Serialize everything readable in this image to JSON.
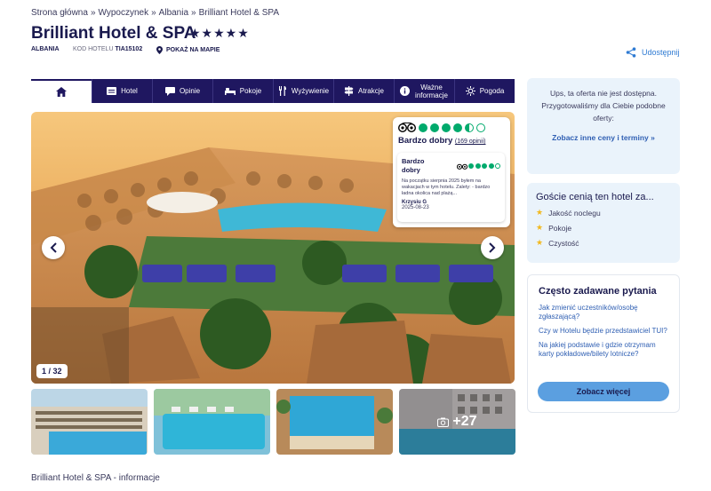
{
  "breadcrumb": [
    "Strona główna",
    "Wypoczynek",
    "Albania",
    "Brilliant Hotel & SPA"
  ],
  "hotel": {
    "name": "Brilliant Hotel & SPA",
    "stars": "★★★★★",
    "country": "ALBANIA",
    "code_label": "KOD HOTELU",
    "code": "TIA15102",
    "map_label": "POKAŻ NA MAPIE",
    "share_label": "Udostępnij"
  },
  "nav": {
    "items": [
      {
        "label": "Hotel",
        "icon": "bed-card-icon"
      },
      {
        "label": "Opinie",
        "icon": "speech-bubble-icon"
      },
      {
        "label": "Pokoje",
        "icon": "bed-icon"
      },
      {
        "label": "Wyżywienie",
        "icon": "cutlery-icon"
      },
      {
        "label": "Atrakcje",
        "icon": "signpost-icon"
      },
      {
        "label": "Ważne informacje",
        "icon": "info-icon"
      },
      {
        "label": "Pogoda",
        "icon": "sun-icon"
      }
    ]
  },
  "gallery": {
    "counter": "1 / 32",
    "more_label": "+27"
  },
  "review": {
    "rating_label": "Bardzo dobry",
    "count_label": "(169 opinii)",
    "rating": 4.5,
    "inner": {
      "label": "Bardzo dobry",
      "rating": 4,
      "text": "Na początku sierpnia 2025 byłem na wakacjach w tym hotelu. Zalety: - bardzo ładna okolica nad plażą...",
      "author": "Krzysiu G",
      "date": "2025-08-23"
    }
  },
  "unavailable": {
    "message": "Ups, ta oferta nie jest dostępna. Przygotowaliśmy dla Ciebie podobne oferty:",
    "link": "Zobacz inne ceny i terminy »"
  },
  "guests": {
    "title": "Goście cenią ten hotel za...",
    "items": [
      "Jakość noclegu",
      "Pokoje",
      "Czystość"
    ]
  },
  "faq": {
    "title": "Często zadawane pytania",
    "questions": [
      "Jak zmienić uczestników/osobę zgłaszającą?",
      "Czy w Hotelu będzie przedstawiciel TUI?",
      "Na jakiej podstawie i gdzie otrzymam karty pokładowe/bilety lotnicze?"
    ],
    "button": "Zobacz więcej"
  },
  "footer": {
    "info_title": "Brilliant Hotel & SPA - informacje"
  },
  "colors": {
    "nav_bg": "#1f1760",
    "brand_text": "#1a1a4e",
    "link": "#2f5fb3",
    "panel_bg": "#eaf3fb",
    "tripadvisor": "#00aa6c",
    "button": "#5b9fe0"
  }
}
